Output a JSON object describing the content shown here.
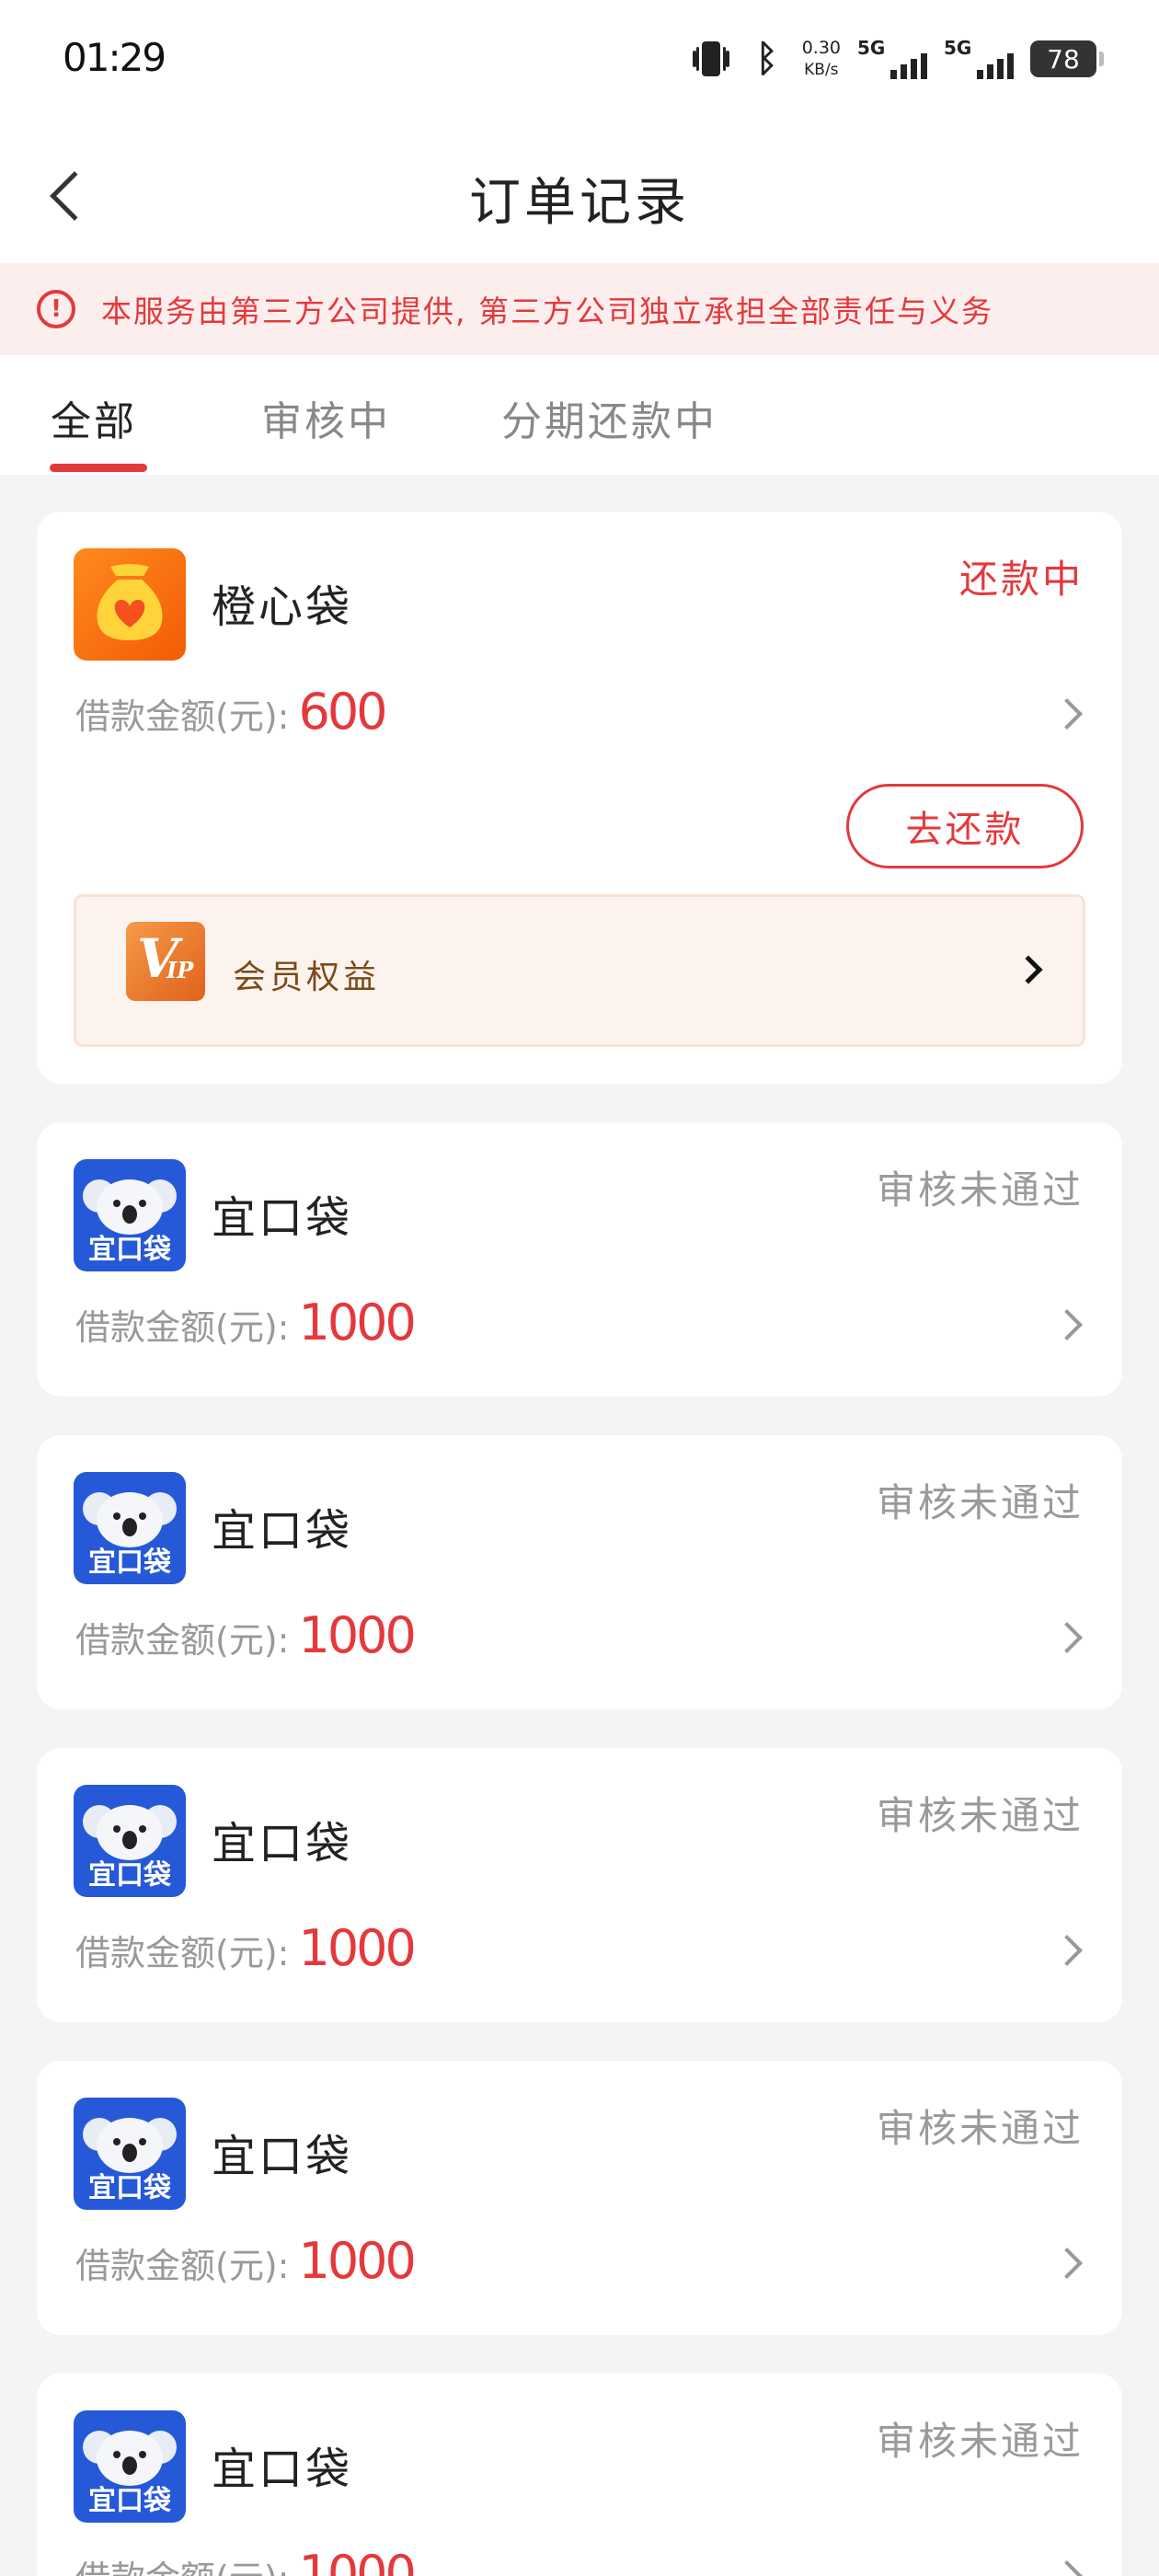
{
  "status_bar": {
    "time": "01:29",
    "net_speed_value": "0.30",
    "net_speed_unit": "KB/s",
    "signal1_label": "5G",
    "signal2_label": "5G",
    "battery": "78"
  },
  "header": {
    "title": "订单记录"
  },
  "notice": {
    "text": "本服务由第三方公司提供, 第三方公司独立承担全部责任与义务"
  },
  "tabs": [
    {
      "label": "全部",
      "active": true
    },
    {
      "label": "审核中",
      "active": false
    },
    {
      "label": "分期还款中",
      "active": false
    }
  ],
  "orders": [
    {
      "name": "橙心袋",
      "status": "还款中",
      "amount_label": "借款金额(元):",
      "amount": "600",
      "repay_label": "去还款",
      "vip_label": "会员权益",
      "logo": "money-bag-heart-icon"
    },
    {
      "name": "宜口袋",
      "status": "审核未通过",
      "amount_label": "借款金额(元):",
      "amount": "1000",
      "logo_text": "宜口袋",
      "logo": "koala-icon"
    },
    {
      "name": "宜口袋",
      "status": "审核未通过",
      "amount_label": "借款金额(元):",
      "amount": "1000",
      "logo_text": "宜口袋",
      "logo": "koala-icon"
    },
    {
      "name": "宜口袋",
      "status": "审核未通过",
      "amount_label": "借款金额(元):",
      "amount": "1000",
      "logo_text": "宜口袋",
      "logo": "koala-icon"
    },
    {
      "name": "宜口袋",
      "status": "审核未通过",
      "amount_label": "借款金额(元):",
      "amount": "1000",
      "logo_text": "宜口袋",
      "logo": "koala-icon"
    },
    {
      "name": "宜口袋",
      "status": "审核未通过",
      "amount_label": "借款金额(元):",
      "amount": "1000",
      "logo_text": "宜口袋",
      "logo": "koala-icon"
    }
  ],
  "colors": {
    "accent": "#e4393c",
    "background": "#f4f4f4",
    "status_grey": "#9a9a9a"
  }
}
